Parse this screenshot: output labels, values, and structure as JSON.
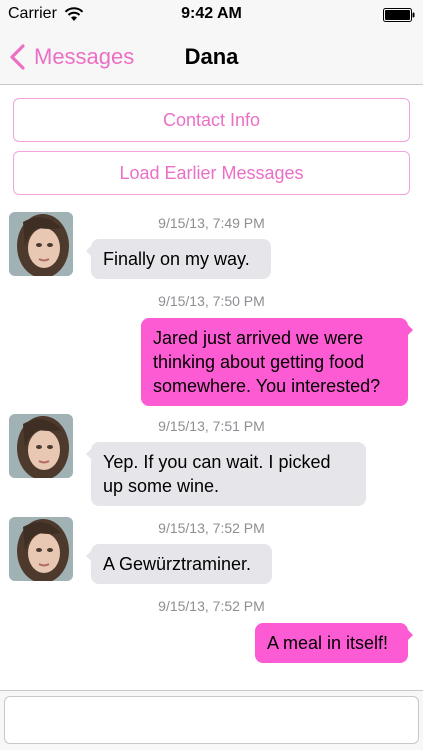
{
  "status_bar": {
    "carrier": "Carrier",
    "time": "9:42 AM"
  },
  "nav": {
    "back_label": "Messages",
    "title": "Dana"
  },
  "buttons": {
    "contact_info": "Contact Info",
    "load_earlier": "Load Earlier Messages"
  },
  "messages": [
    {
      "sender": "Dana",
      "direction": "incoming",
      "timestamp": "9/15/13, 7:49 PM",
      "text": "Finally on my way."
    },
    {
      "sender": "me",
      "direction": "outgoing",
      "timestamp": "9/15/13, 7:50 PM",
      "lines": [
        "Jared just arrived we were",
        "thinking about getting food",
        "somewhere. You interested?"
      ]
    },
    {
      "sender": "Dana",
      "direction": "incoming",
      "timestamp": "9/15/13, 7:51 PM",
      "lines": [
        "Yep. If you can wait. I picked",
        "up some wine."
      ]
    },
    {
      "sender": "Dana",
      "direction": "incoming",
      "timestamp": "9/15/13, 7:52 PM",
      "text": "A Gewürztraminer."
    },
    {
      "sender": "me",
      "direction": "outgoing",
      "timestamp": "9/15/13, 7:52 PM",
      "text": "A meal in itself!"
    }
  ],
  "input": {
    "value": "",
    "placeholder": ""
  },
  "colors": {
    "accent": "#ec6fc6",
    "outgoing_bubble": "#fd5bd3",
    "incoming_bubble": "#e6e5ea"
  },
  "icons": [
    "wifi-icon",
    "battery-icon",
    "back-chevron-icon",
    "avatar"
  ]
}
